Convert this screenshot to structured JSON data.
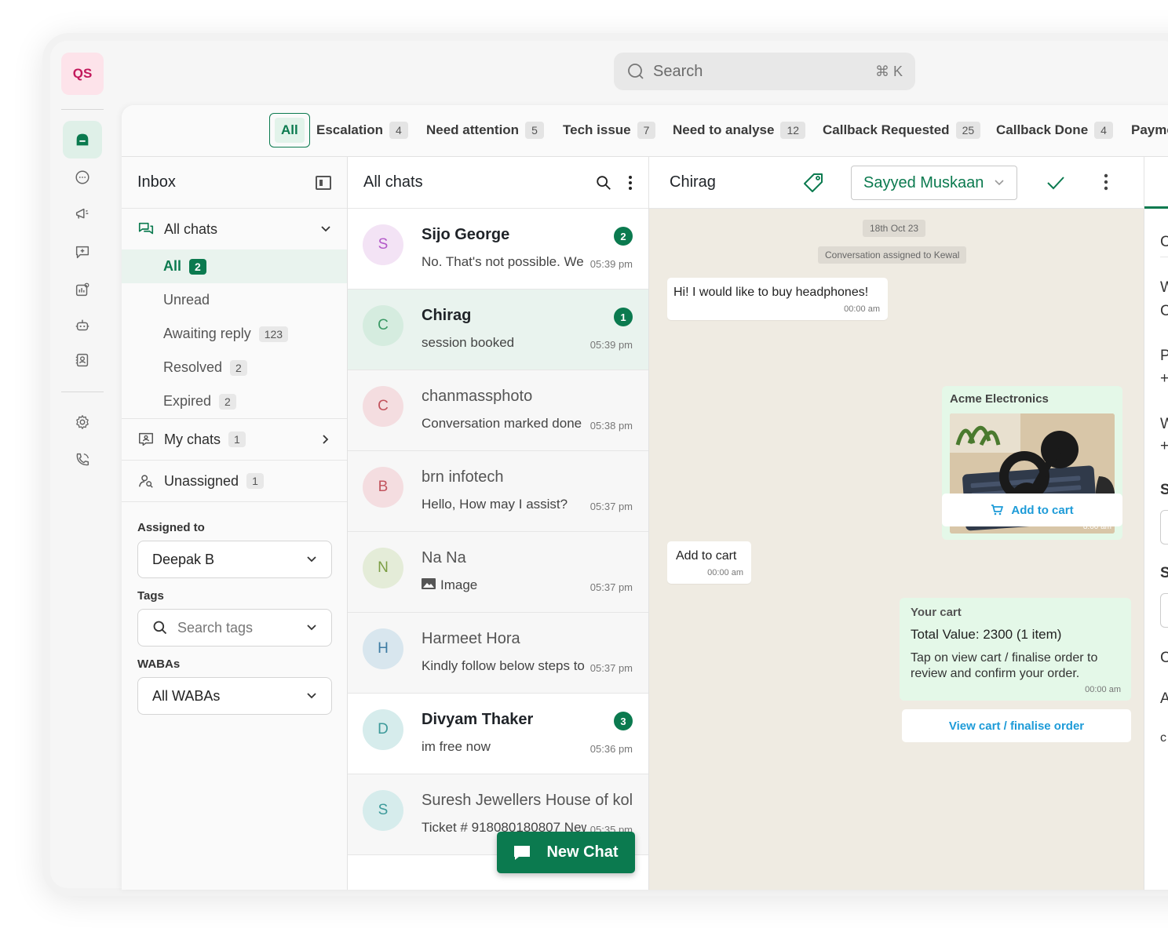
{
  "app": {
    "logo": "QS"
  },
  "search": {
    "placeholder": "Search",
    "shortcut": "⌘ K"
  },
  "tabs": [
    {
      "label": "All",
      "count": ""
    },
    {
      "label": "Escalation",
      "count": "4"
    },
    {
      "label": "Need attention",
      "count": "5"
    },
    {
      "label": "Tech issue",
      "count": "7"
    },
    {
      "label": "Need to analyse",
      "count": "12"
    },
    {
      "label": "Callback Requested",
      "count": "25"
    },
    {
      "label": "Callback Done",
      "count": "4"
    },
    {
      "label": "Payme",
      "count": ""
    }
  ],
  "inbox": {
    "title": "Inbox",
    "all_chats": "All chats",
    "subs": [
      {
        "label": "All",
        "count": "2"
      },
      {
        "label": "Unread",
        "count": ""
      },
      {
        "label": "Awaiting reply",
        "count": "123"
      },
      {
        "label": "Resolved",
        "count": "2"
      },
      {
        "label": "Expired",
        "count": "2"
      }
    ],
    "my_chats": {
      "label": "My chats",
      "count": "1"
    },
    "unassigned": {
      "label": "Unassigned",
      "count": "1"
    },
    "assigned_to_label": "Assigned to",
    "assigned_to_value": "Deepak B",
    "tags_label": "Tags",
    "tags_placeholder": "Search tags",
    "wabas_label": "WABAs",
    "wabas_value": "All WABAs"
  },
  "chat_list": {
    "title": "All chats",
    "items": [
      {
        "initial": "S",
        "name": "Sijo George",
        "preview": "No. That's not possible. We",
        "time": "05:39 pm",
        "badge": "2"
      },
      {
        "initial": "C",
        "name": "Chirag",
        "preview": "session booked",
        "time": "05:39 pm",
        "badge": "1"
      },
      {
        "initial": "C",
        "name": "chanmassphoto",
        "preview": "Conversation marked done",
        "time": "05:38 pm",
        "badge": ""
      },
      {
        "initial": "B",
        "name": "brn infotech",
        "preview": "Hello, How may I assist?",
        "time": "05:37 pm",
        "badge": ""
      },
      {
        "initial": "N",
        "name": "Na Na",
        "preview": "Image",
        "time": "05:37 pm",
        "badge": ""
      },
      {
        "initial": "H",
        "name": "Harmeet Hora",
        "preview": "Kindly follow below steps to",
        "time": "05:37 pm",
        "badge": ""
      },
      {
        "initial": "D",
        "name": "Divyam Thaker",
        "preview": "im free now",
        "time": "05:36 pm",
        "badge": "3"
      },
      {
        "initial": "S",
        "name": "Suresh Jewellers House of kolkata",
        "preview": "Ticket # 918080180807 New",
        "time": "05:35 pm",
        "badge": ""
      }
    ],
    "new_chat": "New Chat"
  },
  "conversation": {
    "contact": "Chirag",
    "assignee": "Sayyed Muskaan",
    "date_chip": "18th Oct 23",
    "system_msg": "Conversation assigned to Kewal",
    "msg1": {
      "text": "Hi! I would like to buy headphones!",
      "time": "00:00 am"
    },
    "product": {
      "seller": "Acme Electronics",
      "time": "8:00 am",
      "button": "Add to cart"
    },
    "msg2": {
      "text": "Add to cart",
      "time": "00:00 am"
    },
    "cart": {
      "title": "Your cart",
      "total": "Total Value: 2300 (1 item)",
      "desc": "Tap on view cart / finalise order to review and confirm your order.",
      "time": "00:00 am",
      "button": "View cart / finalise order"
    }
  },
  "right_panel": {
    "letters": [
      "C",
      "W",
      "C",
      "P",
      "+",
      "W",
      "+",
      "S",
      "S",
      "C",
      "A",
      "c"
    ]
  },
  "colors": {
    "brand": "#0b7a4f",
    "link": "#1d9bd8",
    "chat_bg": "#efebe2",
    "bubble_green": "#e4f8e8"
  }
}
